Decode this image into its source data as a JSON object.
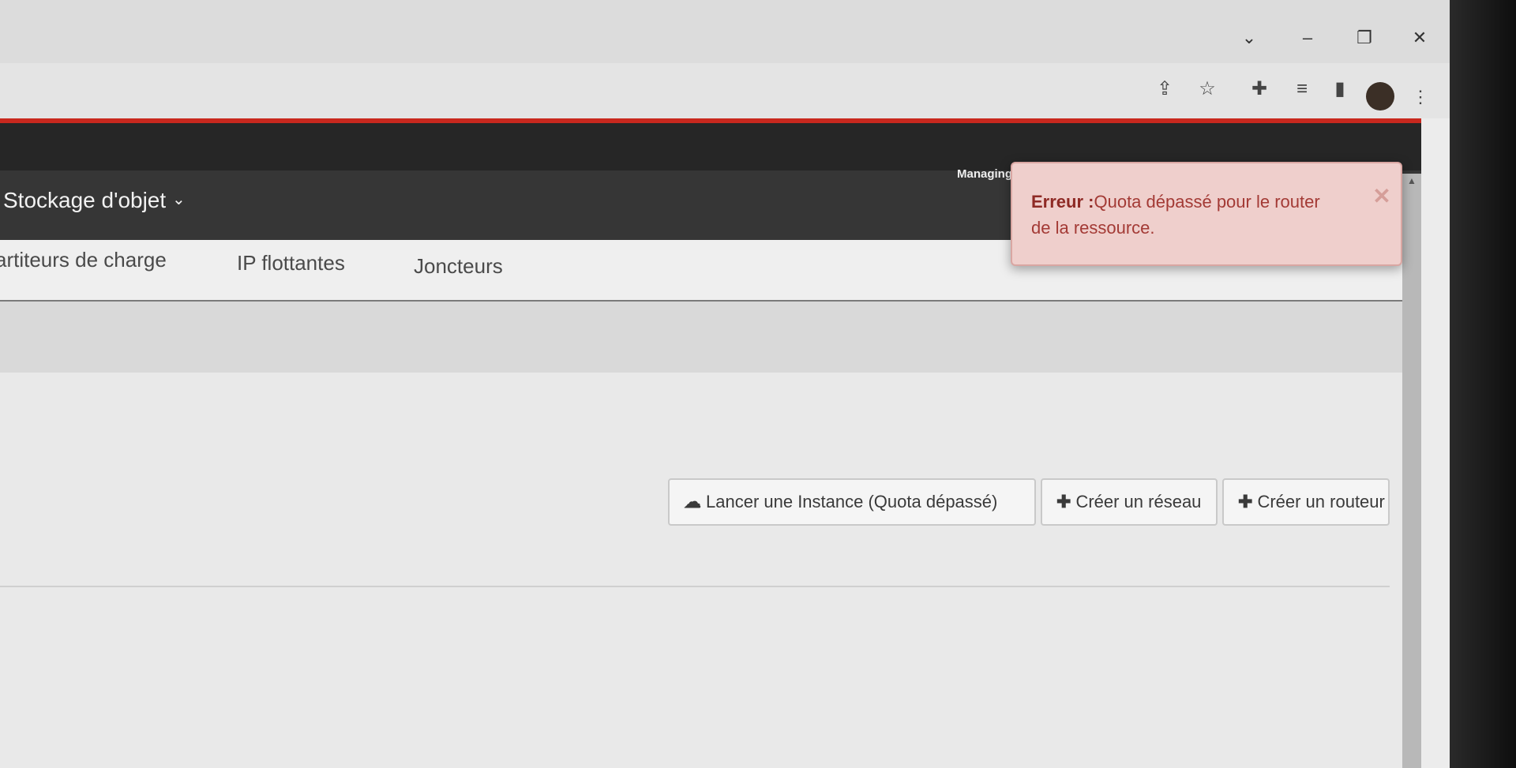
{
  "browser": {
    "controls": {
      "tabs_menu_icon": "chevron-down-icon",
      "minimize_icon": "minimize-icon",
      "restore_icon": "restore-icon",
      "close_icon": "close-icon"
    },
    "toolbar_icons": [
      "share-icon",
      "star-icon",
      "extensions-icon",
      "reading-list-icon",
      "side-panel-icon",
      "profile-avatar",
      "menu-icon"
    ]
  },
  "app": {
    "accent_color": "#c8281e",
    "topbar": {
      "managing_label": "Managing",
      "menu": {
        "label": "Stockage d'objet"
      }
    },
    "alert": {
      "title": "Erreur :",
      "message": "Quota dépassé pour le router de la ressource."
    },
    "tabs": [
      {
        "label": "artiteurs de charge"
      },
      {
        "label": "IP flottantes"
      },
      {
        "label": "Joncteurs"
      }
    ],
    "actions": {
      "launch_instance": "Lancer une Instance (Quota dépassé)",
      "create_network": "Créer un réseau",
      "create_router": "Créer un routeur"
    }
  }
}
